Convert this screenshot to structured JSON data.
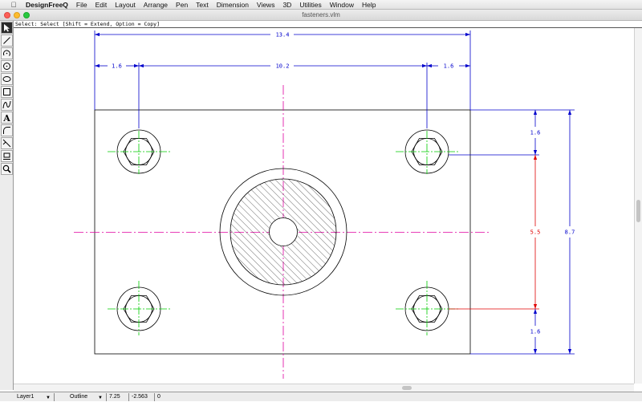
{
  "menubar": {
    "app_name": "DesignFreeQ",
    "items": [
      "File",
      "Edit",
      "Layout",
      "Arrange",
      "Pen",
      "Text",
      "Dimension",
      "Views",
      "3D",
      "Utilities",
      "Window",
      "Help"
    ]
  },
  "window": {
    "title": "fasteners.vlm"
  },
  "status_message": "Select: Select [Shift = Extend, Option = Copy]",
  "drawing": {
    "dimensions": {
      "overall_width": "13.4",
      "left_offset": "1.6",
      "hole_spacing_x": "10.2",
      "right_offset": "1.6",
      "top_offset": "1.6",
      "hole_spacing_y": "5.5",
      "bottom_offset": "1.6",
      "overall_height": "8.7"
    },
    "colors": {
      "outline": "#000000",
      "dimension": "#0000cc",
      "dimension_highlight": "#e00000",
      "hole_centerline": "#00cc00",
      "main_centerline": "#e000a0"
    }
  },
  "bottom_bar": {
    "layer": "Layer1",
    "mode": "Outline",
    "x_readout": "7.25",
    "y_readout": "-2.563",
    "z_readout": "0"
  }
}
